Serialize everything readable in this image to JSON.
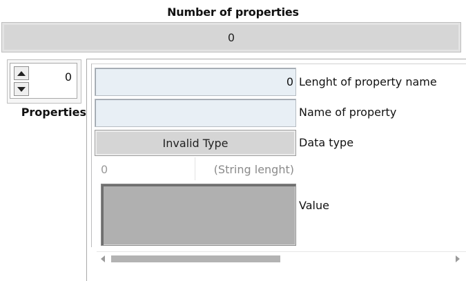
{
  "header": {
    "title": "Number of properties",
    "count_value": "0"
  },
  "array_index": {
    "value": "0",
    "label": "Properties"
  },
  "cluster": {
    "name_length": {
      "value": "0",
      "label": "Lenght of property name"
    },
    "property_name": {
      "value": "",
      "label": "Name of property"
    },
    "data_type": {
      "value": "Invalid Type",
      "label": "Data type"
    },
    "string_length": {
      "value": "0",
      "label": "(String lenght)"
    },
    "value": {
      "label": "Value"
    }
  },
  "icons": {
    "spin_up": "arrow-up-icon",
    "spin_down": "arrow-down-icon",
    "scroll_left": "chevron-left-icon",
    "scroll_right": "chevron-right-icon"
  }
}
